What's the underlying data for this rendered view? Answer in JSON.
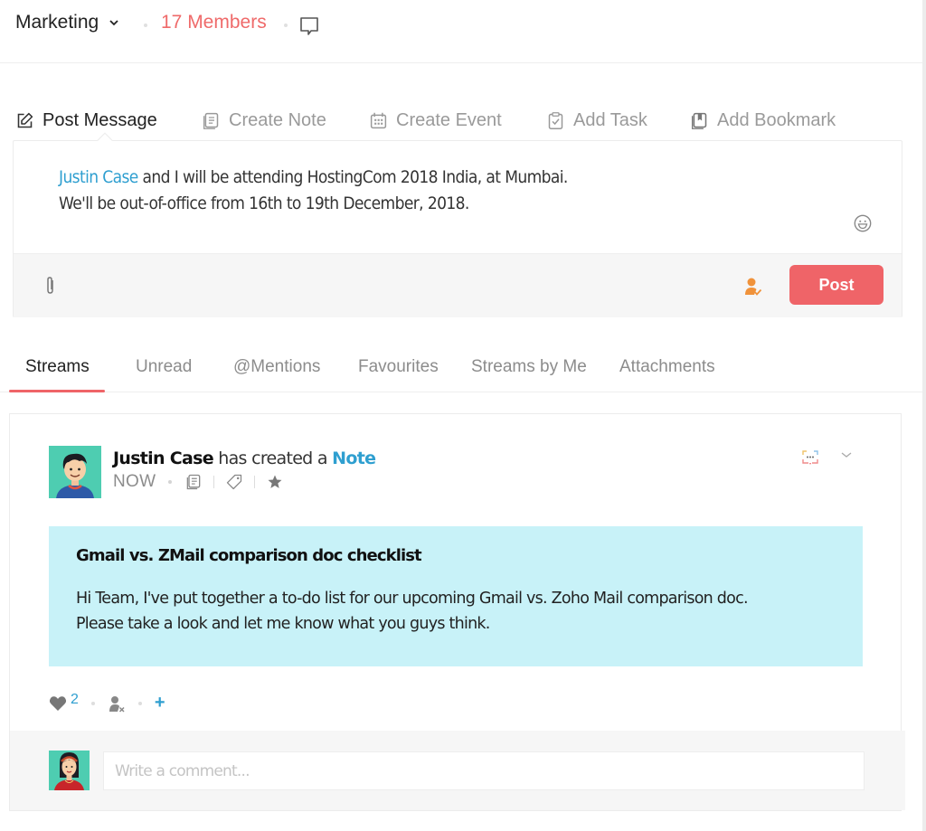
{
  "header": {
    "group_name": "Marketing",
    "members_label": "17 Members",
    "icons": {
      "group_dropdown": "chevron-down-icon",
      "chat": "chat-bubble-icon"
    },
    "accent_color": "#ef6a6a"
  },
  "composer_tabs": [
    {
      "label": "Post Message",
      "icon": "edit-icon",
      "active": true
    },
    {
      "label": "Create Note",
      "icon": "note-icon",
      "active": false
    },
    {
      "label": "Create Event",
      "icon": "calendar-icon",
      "active": false
    },
    {
      "label": "Add Task",
      "icon": "clipboard-check-icon",
      "active": false
    },
    {
      "label": "Add Bookmark",
      "icon": "bookmark-icon",
      "active": false
    }
  ],
  "composer": {
    "mention": "Justin Case",
    "line1_rest": " and I will be attending HostingCom 2018 India, at Mumbai.",
    "line2": "We'll be out-of-office from 16th to 19th December, 2018.",
    "post_label": "Post",
    "post_color": "#ef6468",
    "icons": {
      "emoji": "smiley-icon",
      "attach": "paperclip-icon",
      "assign": "user-check-icon"
    }
  },
  "stream_tabs": [
    {
      "label": "Streams",
      "active": true
    },
    {
      "label": "Unread",
      "active": false
    },
    {
      "label": "@Mentions",
      "active": false
    },
    {
      "label": "Favourites",
      "active": false
    },
    {
      "label": "Streams by Me",
      "active": false
    },
    {
      "label": "Attachments",
      "active": false
    }
  ],
  "feed": {
    "post": {
      "author": "Justin Case",
      "action_text": " has created a ",
      "object_link": "Note",
      "time": "NOW",
      "note_title": "Gmail vs. ZMail comparison doc checklist",
      "note_body_line1": "Hi Team, I've put together a to-do list for our upcoming Gmail vs. Zoho Mail comparison doc.",
      "note_body_line2": "Please take a look and let me know what you guys think.",
      "like_count": "2",
      "add_label": "+",
      "note_bg": "#c8f2f8",
      "link_color": "#2f9fd0"
    },
    "comment": {
      "placeholder": "Write a comment..."
    }
  }
}
